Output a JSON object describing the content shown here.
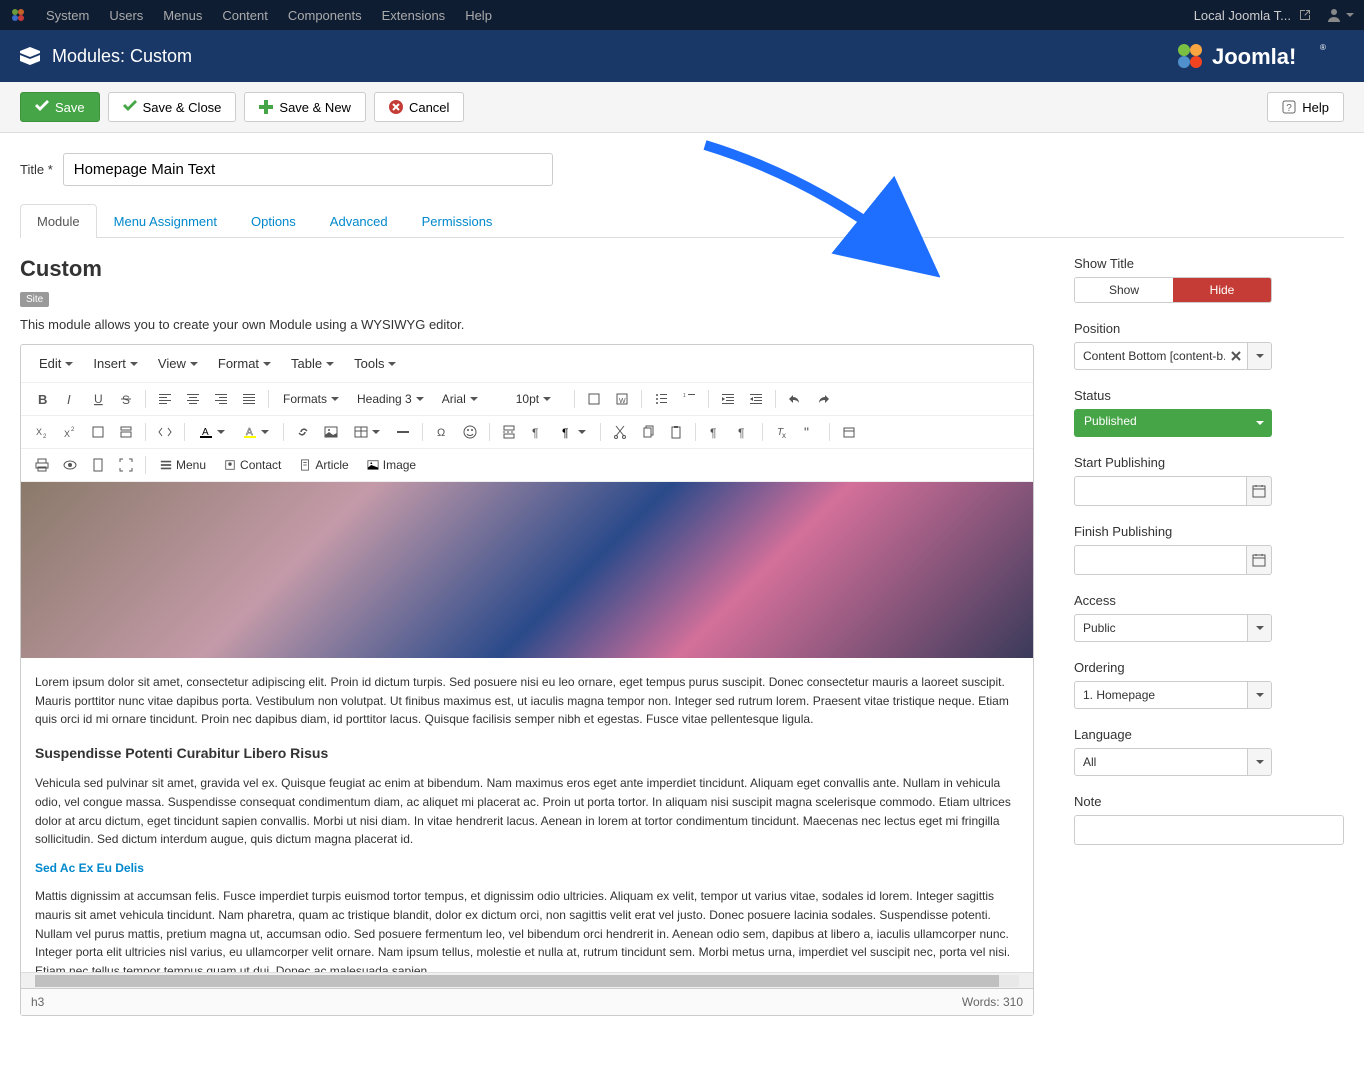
{
  "topnav": {
    "items": [
      "System",
      "Users",
      "Menus",
      "Content",
      "Components",
      "Extensions",
      "Help"
    ],
    "site_name": "Local Joomla T..."
  },
  "header": {
    "title": "Modules: Custom",
    "brand": "Joomla!"
  },
  "toolbar": {
    "save": "Save",
    "save_close": "Save & Close",
    "save_new": "Save & New",
    "cancel": "Cancel",
    "help": "Help"
  },
  "title_field": {
    "label": "Title *",
    "value": "Homepage Main Text"
  },
  "tabs": [
    "Module",
    "Menu Assignment",
    "Options",
    "Advanced",
    "Permissions"
  ],
  "left": {
    "module_title": "Custom",
    "badge": "Site",
    "description": "This module allows you to create your own Module using a WYSIWYG editor.",
    "menubar": [
      "Edit",
      "Insert",
      "View",
      "Format",
      "Table",
      "Tools"
    ],
    "formats_label": "Formats",
    "heading_label": "Heading 3",
    "font_label": "Arial",
    "size_label": "10pt",
    "extra_buttons": [
      "Menu",
      "Contact",
      "Article",
      "Image"
    ],
    "content": {
      "p1": "Lorem ipsum dolor sit amet, consectetur adipiscing elit. Proin id dictum turpis. Sed posuere nisi eu leo ornare, eget tempus purus suscipit. Donec consectetur mauris a laoreet suscipit. Mauris porttitor nunc vitae dapibus porta. Vestibulum non volutpat. Ut finibus maximus est, ut iaculis magna tempor non. Integer sed rutrum lorem. Praesent vitae tristique neque. Etiam quis orci id mi ornare tincidunt. Proin nec dapibus diam, id porttitor lacus. Quisque facilisis semper nibh et egestas. Fusce vitae pellentesque ligula.",
      "h1": "Suspendisse Potenti Curabitur Libero Risus",
      "p2": "Vehicula sed pulvinar sit amet, gravida vel ex. Quisque feugiat ac enim at bibendum. Nam maximus eros eget ante imperdiet tincidunt. Aliquam eget convallis ante. Nullam in vehicula odio, vel congue massa. Suspendisse consequat condimentum diam, ac aliquet mi placerat ac. Proin ut porta tortor. In aliquam nisi suscipit magna scelerisque commodo. Etiam ultrices dolor at arcu dictum, eget tincidunt sapien convallis. Morbi ut nisi diam. In vitae hendrerit lacus. Aenean in lorem at tortor condimentum tincidunt. Maecenas nec lectus eget mi fringilla sollicitudin. Sed dictum interdum augue, quis dictum magna placerat id.",
      "link": "Sed Ac Ex Eu Delis",
      "p3": "Mattis dignissim at accumsan felis. Fusce imperdiet turpis euismod tortor tempus, et dignissim odio ultricies. Aliquam ex velit, tempor ut varius vitae, sodales id lorem. Integer sagittis mauris sit amet vehicula tincidunt. Nam pharetra, quam ac tristique blandit, dolor ex dictum orci, non sagittis velit erat vel justo. Donec posuere lacinia sodales. Suspendisse potenti. Nullam vel purus mattis, pretium magna ut, accumsan odio. Sed posuere fermentum leo, vel bibendum orci hendrerit in. Aenean odio sem, dapibus at libero a, iaculis ullamcorper nunc. Integer porta elit ultricies nisl varius, eu ullamcorper velit ornare. Nam ipsum tellus, molestie et nulla at, rutrum tincidunt sem. Morbi metus urna, imperdiet vel suscipit nec, porta vel nisi. Etiam nec tellus tempor tempus quam ut dui. Donec ac malesuada sapien."
    },
    "status_path": "h3",
    "status_words": "Words: 310"
  },
  "right": {
    "show_title": {
      "label": "Show Title",
      "show": "Show",
      "hide": "Hide"
    },
    "position": {
      "label": "Position",
      "value": "Content Bottom [content-b..."
    },
    "status": {
      "label": "Status",
      "value": "Published"
    },
    "start_pub": {
      "label": "Start Publishing"
    },
    "finish_pub": {
      "label": "Finish Publishing"
    },
    "access": {
      "label": "Access",
      "value": "Public"
    },
    "ordering": {
      "label": "Ordering",
      "value": "1. Homepage"
    },
    "language": {
      "label": "Language",
      "value": "All"
    },
    "note": {
      "label": "Note"
    }
  }
}
